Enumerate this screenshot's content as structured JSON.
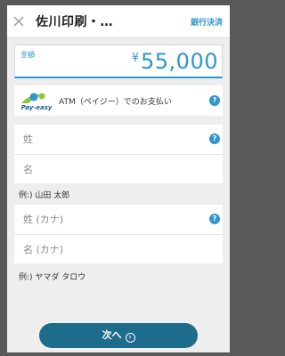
{
  "header": {
    "merchant_name": "佐川印刷・…",
    "bank_link": "銀行決済"
  },
  "amount": {
    "label": "金額",
    "currency_symbol": "¥",
    "value": "55,000"
  },
  "payment_method": {
    "logo_text": "Pay-easy",
    "label": "ATM（ペイジー）でのお支払い",
    "help": "?"
  },
  "name_fields": {
    "last_name_placeholder": "姓",
    "first_name_placeholder": "名",
    "help": "?",
    "example": "例:) 山田 太郎"
  },
  "kana_fields": {
    "last_name_placeholder": "姓 (カナ)",
    "first_name_placeholder": "名 (カナ)",
    "help": "?",
    "example": "例:) ヤマダ タロウ"
  },
  "footer": {
    "next_label": "次へ",
    "next_icon": "arrow-right-circle-icon"
  },
  "colors": {
    "accent": "#2f97c9",
    "button": "#1e6c8c",
    "background": "#eeeeee",
    "backdrop": "#595959"
  }
}
